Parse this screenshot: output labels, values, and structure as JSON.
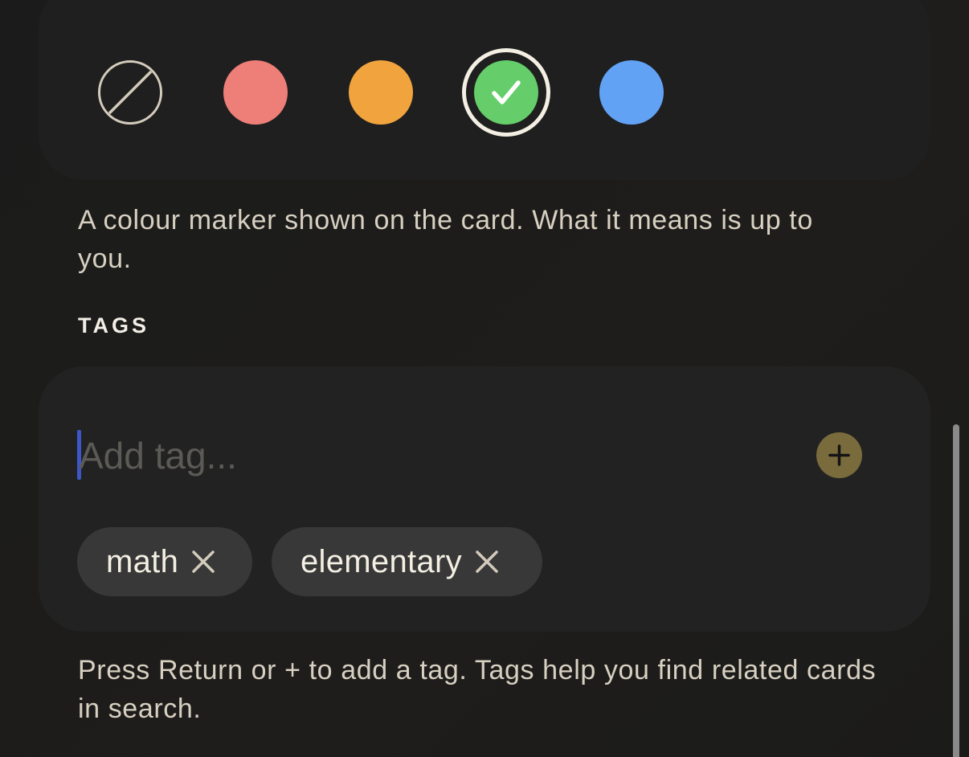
{
  "color_picker": {
    "options": [
      {
        "name": "none",
        "icon": "no-color-icon",
        "selected": false
      },
      {
        "name": "red",
        "color": "#ee7e78",
        "selected": false
      },
      {
        "name": "orange",
        "color": "#f1a43e",
        "selected": false
      },
      {
        "name": "green",
        "color": "#65cd6a",
        "selected": true,
        "icon": "checkmark-icon"
      },
      {
        "name": "blue",
        "color": "#62a2f5",
        "selected": false
      }
    ],
    "hint": "A colour marker shown on the card. What it means is up to you."
  },
  "tags": {
    "heading": "TAGS",
    "input": {
      "placeholder": "Add tag...",
      "value": ""
    },
    "add_button_icon": "plus-icon",
    "chips": [
      {
        "label": "math",
        "remove_icon": "close-icon"
      },
      {
        "label": "elementary",
        "remove_icon": "close-icon"
      }
    ],
    "hint": "Press Return or + to add a tag. Tags help you find related cards in search."
  },
  "colors": {
    "background": "#1c1c1b",
    "card": "#222222",
    "accent_add": "#7a6b3d",
    "caret": "#3f56c6"
  }
}
